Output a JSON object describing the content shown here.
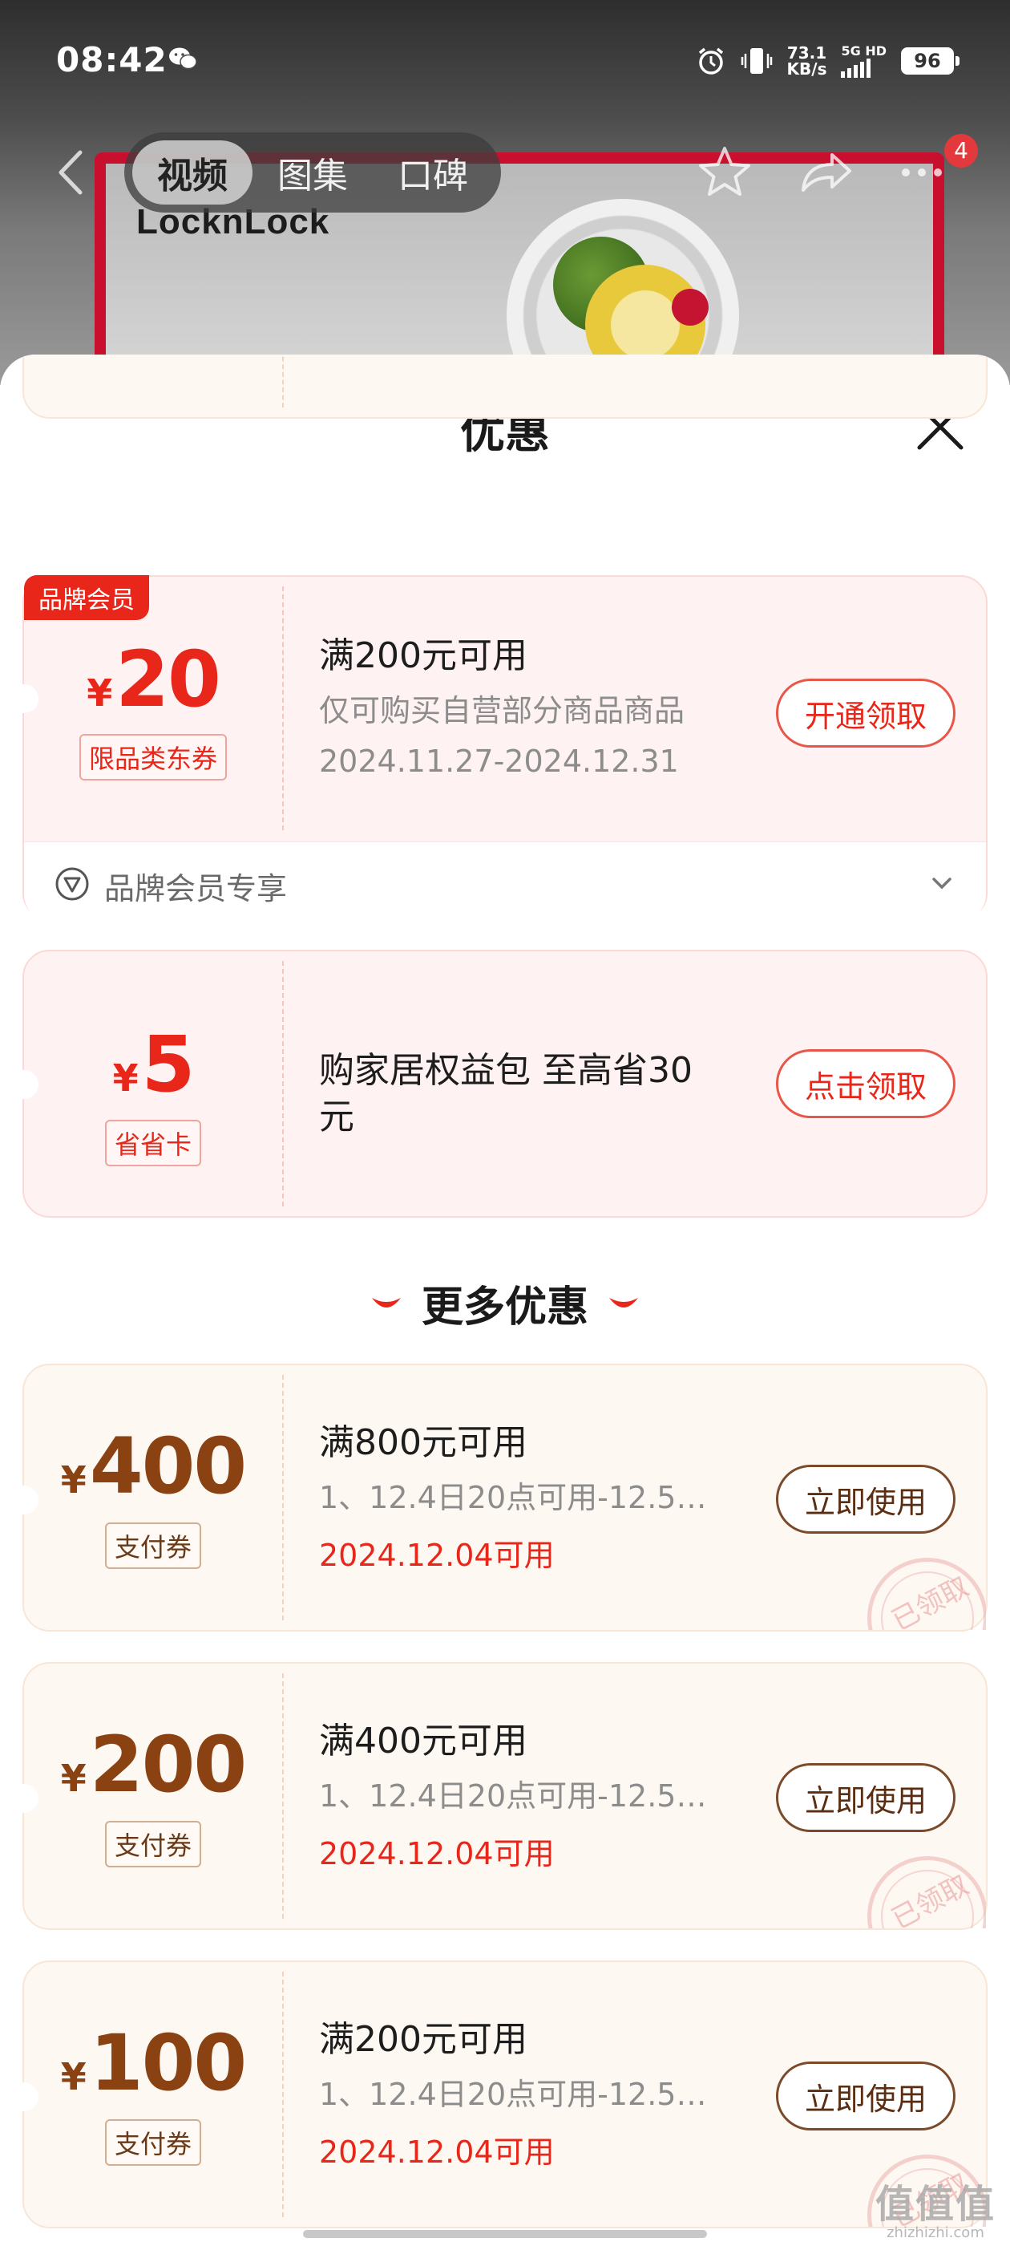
{
  "status_bar": {
    "time": "08:42",
    "net_speed_value": "73.1",
    "net_speed_unit": "KB/s",
    "signal_label_1": "5G",
    "signal_label_2": "HD",
    "battery": "96"
  },
  "nav": {
    "tabs": [
      "视频",
      "图集",
      "口碑"
    ],
    "active_tab": "视频",
    "badge_count": "4"
  },
  "product_image": {
    "brand": "LocknLock"
  },
  "sheet": {
    "title": "优惠",
    "coupons": [
      {
        "badge": "品牌会员",
        "currency": "¥",
        "amount": "20",
        "tag": "限品类东券",
        "condition": "满200元可用",
        "description": "仅可购买自营部分商品商品",
        "date": "2024.11.27-2024.12.31",
        "button": "开通领取",
        "footer": "品牌会员专享"
      },
      {
        "currency": "¥",
        "amount": "5",
        "tag": "省省卡",
        "condition_line1": "购家居权益包 至高省30",
        "condition_line2": "元",
        "button": "点击领取"
      }
    ],
    "more_section_title": "更多优惠",
    "more_coupons": [
      {
        "currency": "¥",
        "amount": "400",
        "tag": "支付券",
        "condition": "满800元可用",
        "description": "1、12.4日20点可用-12.5…",
        "date": "2024.12.04可用",
        "button": "立即使用",
        "stamp": "已领取"
      },
      {
        "currency": "¥",
        "amount": "200",
        "tag": "支付券",
        "condition": "满400元可用",
        "description": "1、12.4日20点可用-12.5…",
        "date": "2024.12.04可用",
        "button": "立即使用",
        "stamp": "已领取"
      },
      {
        "currency": "¥",
        "amount": "100",
        "tag": "支付券",
        "condition": "满200元可用",
        "description": "1、12.4日20点可用-12.5…",
        "date": "2024.12.04可用",
        "button": "立即使用",
        "stamp": "已领取"
      }
    ]
  },
  "watermark": {
    "line1": "值值值",
    "line2": "zhizhizhi.com"
  },
  "colors": {
    "accent_red": "#e8261a",
    "coupon_brown": "#8a4212",
    "sheet_bg": "#ffffff"
  }
}
